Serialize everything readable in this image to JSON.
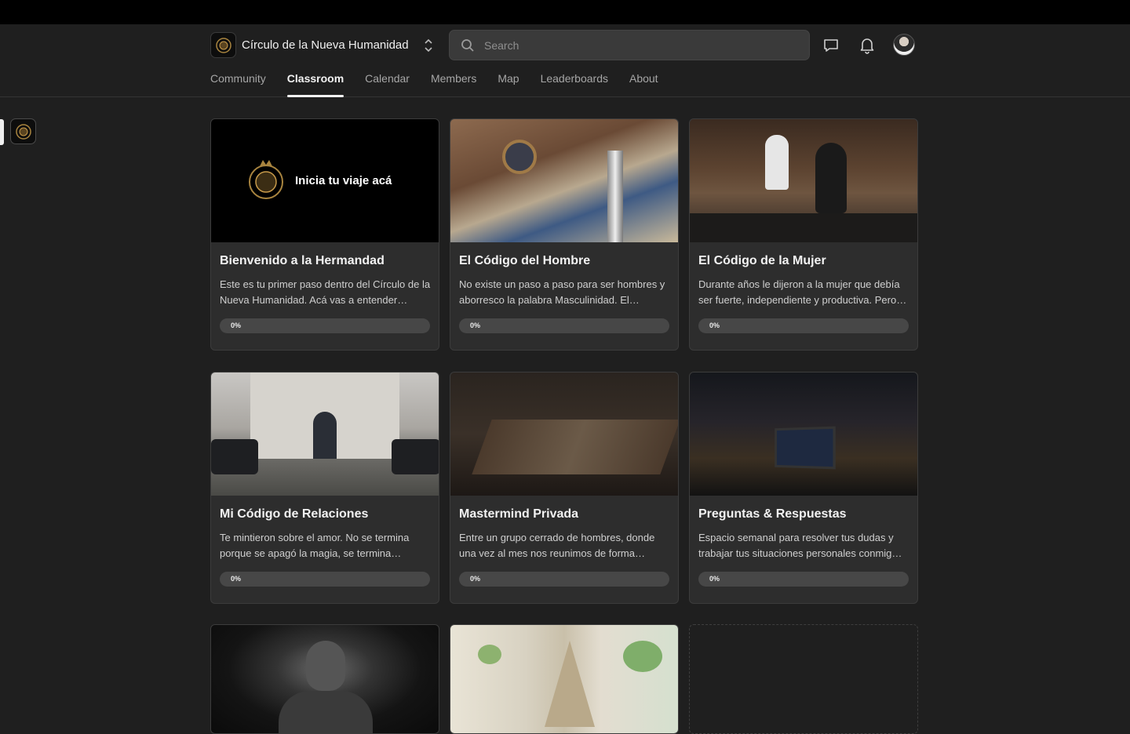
{
  "header": {
    "community_name": "Círculo de la Nueva Humanidad",
    "search_placeholder": "Search"
  },
  "tabs": [
    {
      "label": "Community"
    },
    {
      "label": "Classroom",
      "active": true
    },
    {
      "label": "Calendar"
    },
    {
      "label": "Members"
    },
    {
      "label": "Map"
    },
    {
      "label": "Leaderboards"
    },
    {
      "label": "About"
    }
  ],
  "courses": [
    {
      "title": "Bienvenido a la Hermandad",
      "description": "Este es tu primer paso dentro del Círculo de la Nueva Humanidad. Acá vas a entender…",
      "progress": "0%",
      "image_text": "Inicia tu viaje acá"
    },
    {
      "title": "El Código del Hombre",
      "description": "No existe un paso a paso para ser hombres y aborresco la palabra Masculinidad. El…",
      "progress": "0%"
    },
    {
      "title": "El Código de la Mujer",
      "description": "Durante años le dijeron a la mujer que debía ser fuerte, independiente y productiva. Pero…",
      "progress": "0%"
    },
    {
      "title": "Mi Código de Relaciones",
      "description": "Te mintieron sobre el amor. No se termina porque se apagó la magia, se termina…",
      "progress": "0%"
    },
    {
      "title": "Mastermind Privada",
      "description": "Entre un grupo cerrado de hombres, donde una vez al mes nos reunimos de forma…",
      "progress": "0%"
    },
    {
      "title": "Preguntas & Respuestas",
      "description": "Espacio semanal para resolver tus dudas y trabajar tus situaciones personales conmig…",
      "progress": "0%"
    }
  ],
  "colors": {
    "background": "#1f1f1f",
    "card": "#2d2d2d",
    "accent": "#f2f2f2"
  }
}
